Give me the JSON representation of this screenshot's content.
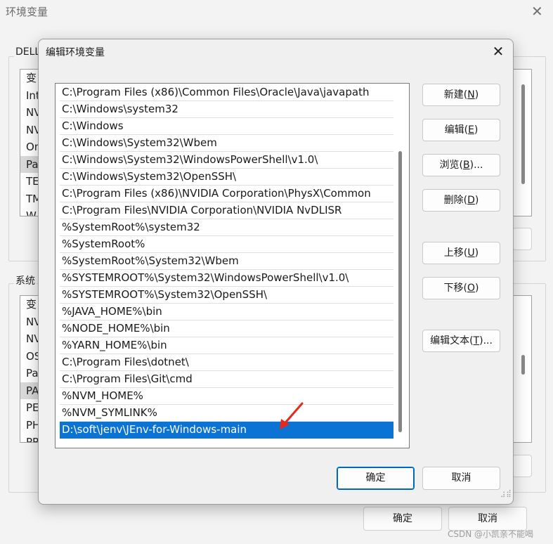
{
  "background_window": {
    "title": "环境变量",
    "close": "✕",
    "user_group_label": "DELL",
    "user_list_items": [
      "变",
      "Int",
      "NV",
      "NV",
      "On",
      "Pa",
      "TE",
      "TM",
      "W"
    ],
    "system_group_label": "系统",
    "system_list_items": [
      "变",
      "NV",
      "NV",
      "OS",
      "Pa",
      "PA",
      "PE",
      "PH",
      "PR"
    ],
    "ok_label": "确定",
    "cancel_label": "取消"
  },
  "dialog": {
    "title": "编辑环境变量",
    "close": "✕",
    "path_entries": [
      "C:\\Program Files (x86)\\Common Files\\Oracle\\Java\\javapath",
      "C:\\Windows\\system32",
      "C:\\Windows",
      "C:\\Windows\\System32\\Wbem",
      "C:\\Windows\\System32\\WindowsPowerShell\\v1.0\\",
      "C:\\Windows\\System32\\OpenSSH\\",
      "C:\\Program Files (x86)\\NVIDIA Corporation\\PhysX\\Common",
      "C:\\Program Files\\NVIDIA Corporation\\NVIDIA NvDLISR",
      "%SystemRoot%\\system32",
      "%SystemRoot%",
      "%SystemRoot%\\System32\\Wbem",
      "%SYSTEMROOT%\\System32\\WindowsPowerShell\\v1.0\\",
      "%SYSTEMROOT%\\System32\\OpenSSH\\",
      "%JAVA_HOME%\\bin",
      "%NODE_HOME%\\bin",
      "%YARN_HOME%\\bin",
      "C:\\Program Files\\dotnet\\",
      "C:\\Program Files\\Git\\cmd",
      "%NVM_HOME%",
      "%NVM_SYMLINK%",
      "D:\\soft\\jenv\\JEnv-for-Windows-main"
    ],
    "selected_index": 20,
    "buttons": {
      "new": {
        "text": "新建(",
        "key": "N",
        "close": ")"
      },
      "edit": {
        "text": "编辑(",
        "key": "E",
        "close": ")"
      },
      "browse": {
        "text": "浏览(",
        "key": "B",
        "close": ")..."
      },
      "delete": {
        "text": "删除(",
        "key": "D",
        "close": ")"
      },
      "move_up": {
        "text": "上移(",
        "key": "U",
        "close": ")"
      },
      "move_down": {
        "text": "下移(",
        "key": "O",
        "close": ")"
      },
      "edit_text": {
        "text": "编辑文本(",
        "key": "T",
        "close": ")..."
      }
    },
    "ok_label": "确定",
    "cancel_label": "取消"
  },
  "watermark": "CSDN @小凯亲不能喝",
  "colors": {
    "selection": "#0a73d4",
    "arrow": "#e8281d",
    "default_button_border": "#0067c0"
  }
}
